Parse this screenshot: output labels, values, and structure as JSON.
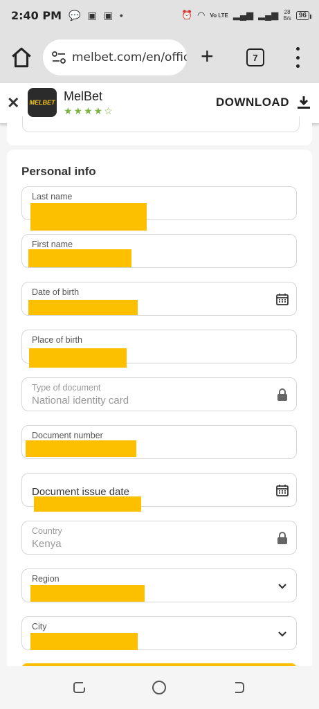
{
  "status_bar": {
    "time": "2:40 PM",
    "net_speed_value": "28",
    "net_speed_unit": "B/s",
    "network_label": "Vo LTE",
    "battery": "96"
  },
  "browser": {
    "url": "melbet.com/en/offic",
    "tab_count": "7"
  },
  "app_banner": {
    "name": "MelBet",
    "logo_text": "MELBET",
    "stars": "★★★★☆",
    "rating": 4.5,
    "download_label": "DOWNLOAD"
  },
  "form": {
    "title": "Personal info",
    "fields": [
      {
        "label": "Last name",
        "value": "",
        "type": "text",
        "redacted": true
      },
      {
        "label": "First name",
        "value": "",
        "type": "text",
        "redacted": true
      },
      {
        "label": "Date of birth",
        "value": "",
        "type": "date",
        "redacted": true
      },
      {
        "label": "Place of birth",
        "value": "",
        "type": "text",
        "redacted": true
      },
      {
        "label": "Type of document",
        "value": "National identity card",
        "type": "locked"
      },
      {
        "label": "Document number",
        "value": "",
        "type": "text",
        "redacted": true
      },
      {
        "label": "Document issue date",
        "value": "",
        "type": "date",
        "redacted": true
      },
      {
        "label": "Country",
        "value": "Kenya",
        "type": "locked"
      },
      {
        "label": "Region",
        "value": "",
        "type": "select",
        "redacted": true
      },
      {
        "label": "City",
        "value": "",
        "type": "select",
        "redacted": true
      }
    ]
  },
  "colors": {
    "accent": "#fdc000",
    "star_green": "#7cb342",
    "chrome_bg": "#e2e2e2"
  },
  "icons": [
    "home-icon",
    "site-settings-icon",
    "plus-icon",
    "tabs-icon",
    "more-vert-icon",
    "close-icon",
    "download-icon",
    "calendar-icon",
    "lock-icon",
    "chevron-down-icon",
    "recents-icon",
    "home-circle-icon",
    "back-icon"
  ]
}
